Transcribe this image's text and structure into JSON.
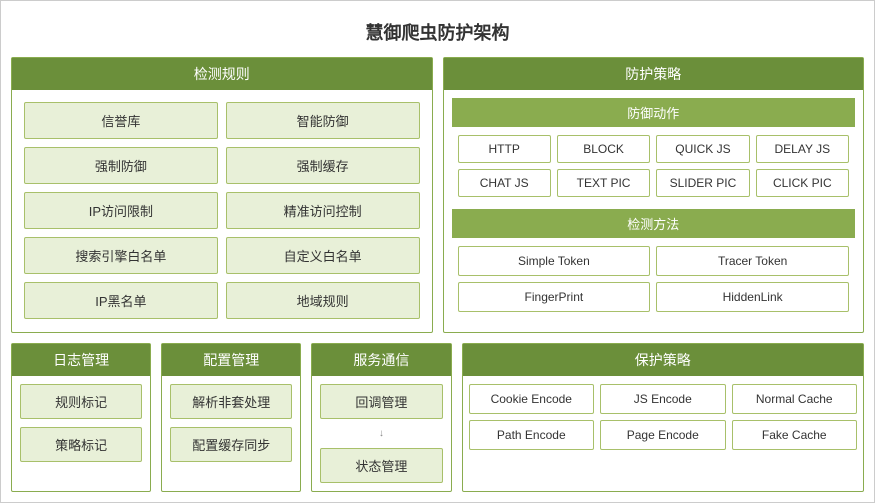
{
  "title": "慧御爬虫防护架构",
  "detection_rules": {
    "header": "检测规则",
    "items": [
      "信誉库",
      "智能防御",
      "强制防御",
      "强制缓存",
      "IP访问限制",
      "精准访问控制",
      "搜索引擎白名单",
      "自定义白名单",
      "IP黑名单",
      "地域规则"
    ]
  },
  "protection_policy": {
    "header": "防护策略",
    "defense_action": {
      "header": "防御动作",
      "items": [
        "HTTP",
        "BLOCK",
        "QUICK JS",
        "DELAY JS",
        "CHAT JS",
        "TEXT PIC",
        "SLIDER PIC",
        "CLICK PIC"
      ]
    },
    "detect_method": {
      "header": "检测方法",
      "items": [
        "Simple Token",
        "Tracer Token",
        "FingerPrint",
        "HiddenLink"
      ]
    },
    "protect_strategy": {
      "header": "保护策略",
      "items": [
        "Cookie Encode",
        "JS Encode",
        "Normal Cache",
        "Path Encode",
        "Page Encode",
        "Fake Cache"
      ]
    }
  },
  "log_management": {
    "header": "日志管理",
    "items": [
      "规则标记",
      "策略标记"
    ]
  },
  "config_management": {
    "header": "配置管理",
    "items": [
      "解析非套处理",
      "配置缓存同步"
    ]
  },
  "service_comm": {
    "header": "服务通信",
    "items": [
      "回调管理",
      "状态管理"
    ]
  }
}
